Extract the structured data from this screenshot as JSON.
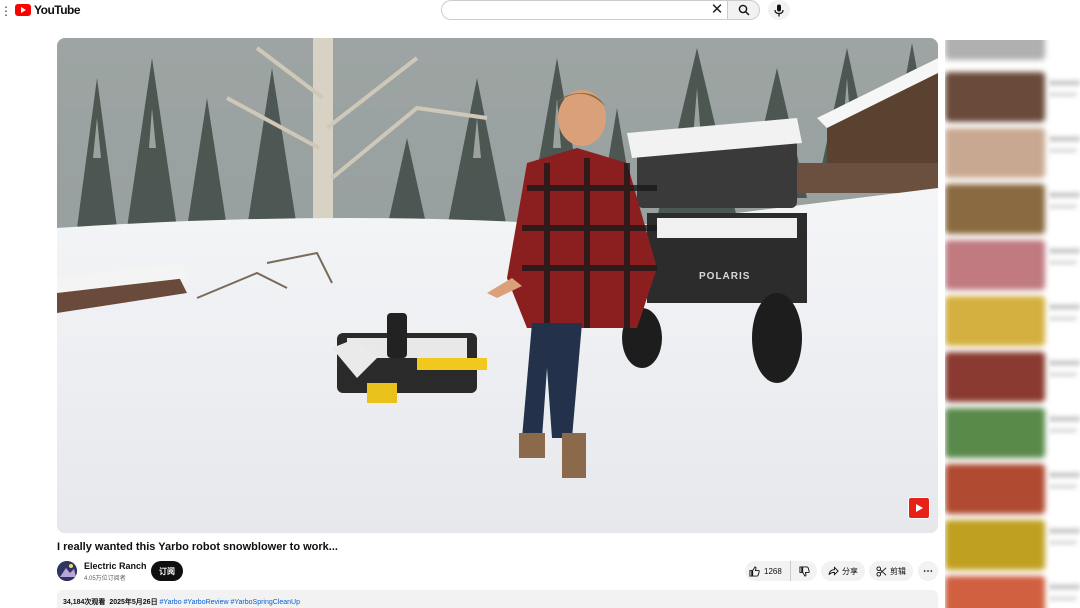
{
  "app": {
    "logo_text": "YouTube"
  },
  "search": {
    "value": "",
    "placeholder": ""
  },
  "video": {
    "title": "I really wanted this Yarbo robot snowblower to work...",
    "truck_brand": "POLARIS"
  },
  "channel": {
    "name": "Electric Ranch",
    "subscribers": "4.05万位订阅者",
    "subscribe_label": "订阅"
  },
  "actions": {
    "like_count": "1268",
    "share_label": "分享",
    "clip_label": "剪辑"
  },
  "description": {
    "views": "34,184次观看",
    "date": "2025年5月26日",
    "hashtags": "#Yarbo #YarboReview #YarboSpringCleanUp"
  },
  "colors": {
    "brand_red": "#ff0000",
    "link_blue": "#065fd4",
    "subscribe_bg": "#0f0f0f"
  },
  "sidebar": {
    "thumb_colors": [
      "#b0b0b0",
      "#6a4a3a",
      "#c8a890",
      "#8a6a40",
      "#c07a80",
      "#d4b040",
      "#8a3a30",
      "#5a8a4a",
      "#b04a30",
      "#c0a020",
      "#d06040"
    ]
  }
}
